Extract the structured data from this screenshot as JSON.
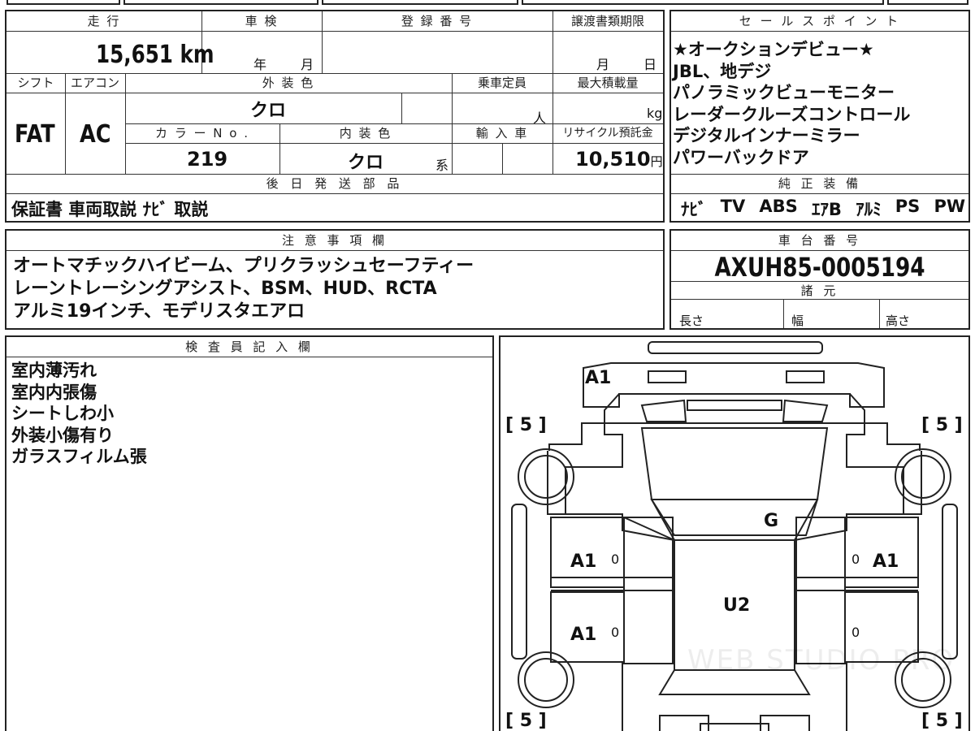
{
  "header_tabs": [
    "",
    "",
    "",
    "",
    "",
    ""
  ],
  "main": {
    "mileage_label": "走 行",
    "mileage_value": "15,651",
    "mileage_unit": "km",
    "inspection_label": "車 検",
    "inspection_year": "年",
    "inspection_month": "月",
    "registration_label": "登 録 番 号",
    "registration_value": "",
    "transfer_label": "譲渡書類期限",
    "transfer_month": "月",
    "transfer_day": "日",
    "shift_label": "シフト",
    "shift_value": "FAT",
    "ac_label": "エアコン",
    "ac_value": "AC",
    "exterior_label": "外 装 色",
    "exterior_value": "クロ",
    "capacity_label": "乗車定員",
    "capacity_unit": "人",
    "maxload_label": "最大積載量",
    "maxload_unit": "kg",
    "color_no_label": "カ ラ ー N o .",
    "color_no_value": "219",
    "interior_label": "内 装 色",
    "interior_value": "クロ",
    "interior_suffix": "系",
    "import_label": "輸 入 車",
    "recycle_label": "リサイクル預託金",
    "recycle_value": "10,510",
    "recycle_unit": "円",
    "later_parts_label": "後 日 発 送 部 品",
    "later_parts_value": "保証書 車両取説 ﾅﾋﾞ 取説"
  },
  "sales": {
    "label": "セ ー ル ス ポ イ ン ト",
    "lines": [
      "★オークションデビュー★",
      "JBL、地デジ",
      "パノラミックビューモニター",
      "レーダークルーズコントロール",
      "デジタルインナーミラー",
      "パワーバックドア"
    ]
  },
  "equipment": {
    "label": "純 正 装 備",
    "items": [
      "ﾅﾋﾞ",
      "TV",
      "ABS",
      "ｴｱB",
      "ｱﾙﾐ",
      "PS",
      "PW"
    ]
  },
  "notes": {
    "label": "注 意 事 項 欄",
    "lines": [
      "オートマチックハイビーム、プリクラッシュセーフティー",
      "レーントレーシングアシスト、BSM、HUD、RCTA",
      "アルミ19インチ、モデリスタエアロ"
    ]
  },
  "chassis": {
    "label": "車 台 番 号",
    "value": "AXUH85-0005194",
    "specs_label": "諸 元",
    "length_label": "長さ",
    "width_label": "幅",
    "height_label": "高さ"
  },
  "inspector": {
    "label": "検 査 員 記 入 欄",
    "lines": [
      "室内薄汚れ",
      "室内内張傷",
      "シートしわ小",
      "外装小傷有り",
      "ガラスフィルム張"
    ]
  },
  "diagram": {
    "front_bumper": "A1",
    "tire_fl": "[ 5 ]",
    "tire_fr": "[ 5 ]",
    "tire_rl": "[ 5 ]",
    "tire_rr": "[ 5 ]",
    "windshield": "G",
    "roof": "U2",
    "left_front_door": "A1",
    "left_rear_door": "A1",
    "right_front_door": "A1",
    "door_zero": "0",
    "watermark": "WEB STUDIO PRO"
  }
}
